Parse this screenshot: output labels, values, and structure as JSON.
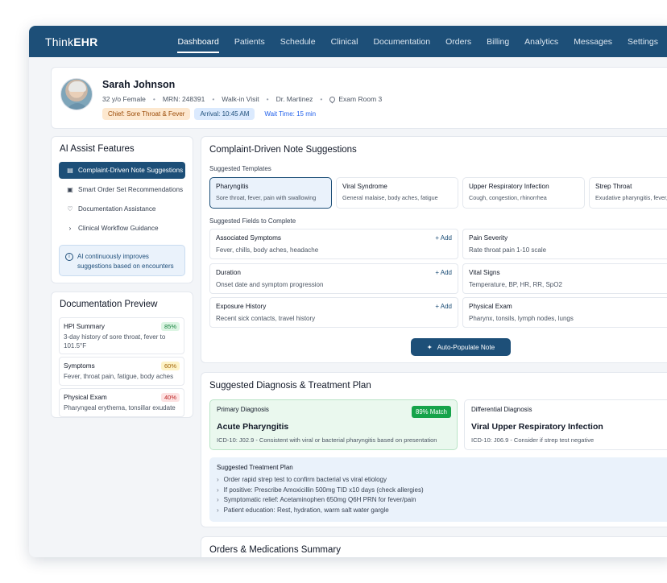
{
  "app": {
    "brand_prefix": "Think",
    "brand_suffix": "EHR"
  },
  "nav": {
    "items": [
      "Dashboard",
      "Patients",
      "Schedule",
      "Clinical",
      "Documentation",
      "Orders",
      "Billing",
      "Analytics",
      "Messages",
      "Settings"
    ],
    "active": "Dashboard"
  },
  "patient": {
    "name": "Sarah Johnson",
    "age_sex": "32 y/o Female",
    "mrn": "MRN: 248391",
    "visit_type": "Walk-in Visit",
    "provider": "Dr. Martinez",
    "room": "Exam Room 3",
    "chief": "Chief: Sore Throat & Fever",
    "arrival": "Arrival: 10:45 AM",
    "wait": "Wait Time: 15 min"
  },
  "ai_assist": {
    "title": "AI Assist Features",
    "items": [
      {
        "label": "Complaint-Driven Note Suggestions",
        "icon": "document-icon"
      },
      {
        "label": "Smart Order Set Recommendations",
        "icon": "clipboard-icon"
      },
      {
        "label": "Documentation Assistance",
        "icon": "stethoscope-icon"
      },
      {
        "label": "Clinical Workflow Guidance",
        "icon": "chevron-right-icon"
      }
    ],
    "note": "AI continuously improves suggestions based on encounters"
  },
  "doc_preview": {
    "title": "Documentation Preview",
    "items": [
      {
        "label": "HPI Summary",
        "pct": "85%",
        "text": "3-day history of sore throat, fever to 101.5°F"
      },
      {
        "label": "Symptoms",
        "pct": "60%",
        "text": "Fever, throat pain, fatigue, body aches"
      },
      {
        "label": "Physical Exam",
        "pct": "40%",
        "text": "Pharyngeal erythema, tonsillar exudate"
      }
    ]
  },
  "complaint": {
    "title": "Complaint-Driven Note Suggestions",
    "templates_label": "Suggested Templates",
    "templates": [
      {
        "title": "Pharyngitis",
        "text": "Sore throat, fever, pain with swallowing"
      },
      {
        "title": "Viral Syndrome",
        "text": "General malaise, body aches, fatigue"
      },
      {
        "title": "Upper Respiratory Infection",
        "text": "Cough, congestion, rhinorrhea"
      },
      {
        "title": "Strep Throat",
        "text": "Exudative pharyngitis, fever, lymphadenopathy"
      }
    ],
    "fields_label": "Suggested Fields to Complete",
    "add_label": "+ Add",
    "fields": [
      {
        "title": "Associated Symptoms",
        "text": "Fever, chills, body aches, headache",
        "add": true
      },
      {
        "title": "Pain Severity",
        "text": "Rate throat pain 1-10 scale",
        "add": false
      },
      {
        "title": "Duration",
        "text": "Onset date and symptom progression",
        "add": true
      },
      {
        "title": "Vital Signs",
        "text": "Temperature, BP, HR, RR, SpO2",
        "add": false
      },
      {
        "title": "Exposure History",
        "text": "Recent sick contacts, travel history",
        "add": true
      },
      {
        "title": "Physical Exam",
        "text": "Pharynx, tonsils, lymph nodes, lungs",
        "add": false
      }
    ],
    "auto_button": "Auto-Populate Note"
  },
  "diagnosis": {
    "title": "Suggested Diagnosis & Treatment Plan",
    "primary": {
      "label": "Primary Diagnosis",
      "match": "89% Match",
      "name": "Acute Pharyngitis",
      "code": "ICD-10: J02.9 - Consistent with viral or bacterial pharyngitis based on presentation"
    },
    "differential": {
      "label": "Differential Diagnosis",
      "name": "Viral Upper Respiratory Infection",
      "code": "ICD-10: J06.9 - Consider if strep test negative"
    },
    "plan_title": "Suggested Treatment Plan",
    "plan": [
      "Order rapid strep test to confirm bacterial vs viral etiology",
      "If positive: Prescribe Amoxicillin 500mg TID x10 days (check allergies)",
      "Symptomatic relief: Acetaminophen 650mg Q6H PRN for fever/pain",
      "Patient education: Rest, hydration, warm salt water gargle"
    ]
  },
  "orders": {
    "title": "Orders & Medications Summary"
  },
  "colors": {
    "primary": "#1d4f78",
    "success": "#16a34a",
    "page_bg": "#f3f5f8"
  }
}
